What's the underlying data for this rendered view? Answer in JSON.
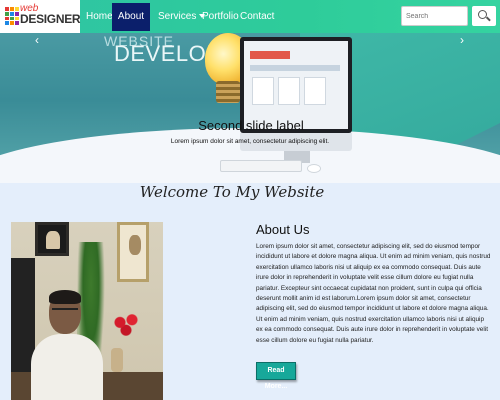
{
  "logo": {
    "line1": "web",
    "line2": "DESIGNER",
    "grid_colors": [
      "#e53935",
      "#fb8c00",
      "#fdd835",
      "#43a047",
      "#1e88e5",
      "#8e24aa",
      "#e53935",
      "#43a047",
      "#fdd835",
      "#1e88e5",
      "#fb8c00",
      "#8e24aa"
    ]
  },
  "nav": {
    "home": "Home",
    "about": "About Me",
    "services": "Services",
    "portfolio": "Portfolio",
    "contact": "Contact",
    "active": "About Me"
  },
  "search": {
    "placeholder": "Search"
  },
  "carousel": {
    "hero_line1": "WEBSITE",
    "hero_line2": "DEVELOPMENT",
    "slide_title": "Second slide label",
    "slide_text": "Lorem ipsum dolor sit amet, consectetur adipiscing elit.",
    "prev_symbol": "‹",
    "next_symbol": "›"
  },
  "welcome": "Welcome To My Website",
  "about": {
    "title": "About Us",
    "body": "Lorem ipsum dolor sit amet, consectetur adipiscing elit, sed do eiusmod tempor incididunt ut labore et dolore magna aliqua. Ut enim ad minim veniam, quis nostrud exercitation ullamco laboris nisi ut aliquip ex ea commodo consequat. Duis aute irure dolor in reprehenderit in voluptate velit esse cillum dolore eu fugiat nulla pariatur. Excepteur sint occaecat cupidatat non proident, sunt in culpa qui officia deserunt mollit anim id est laborum.Lorem ipsum dolor sit amet, consectetur adipiscing elit, sed do eiusmod tempor incididunt ut labore et dolore magna aliqua. Ut enim ad minim veniam, quis nostrud exercitation ullamco laboris nisi ut aliquip ex ea commodo consequat. Duis aute irure dolor in reprehenderit in voluptate velit esse cillum dolore eu fugiat nulla pariatur.",
    "button": "Read More..."
  },
  "colors": {
    "nav_bg": "#2ecc9a",
    "nav_active_bg": "#0b1f6b",
    "page_bg": "#e4eefb",
    "button_bg": "#17a89a"
  }
}
